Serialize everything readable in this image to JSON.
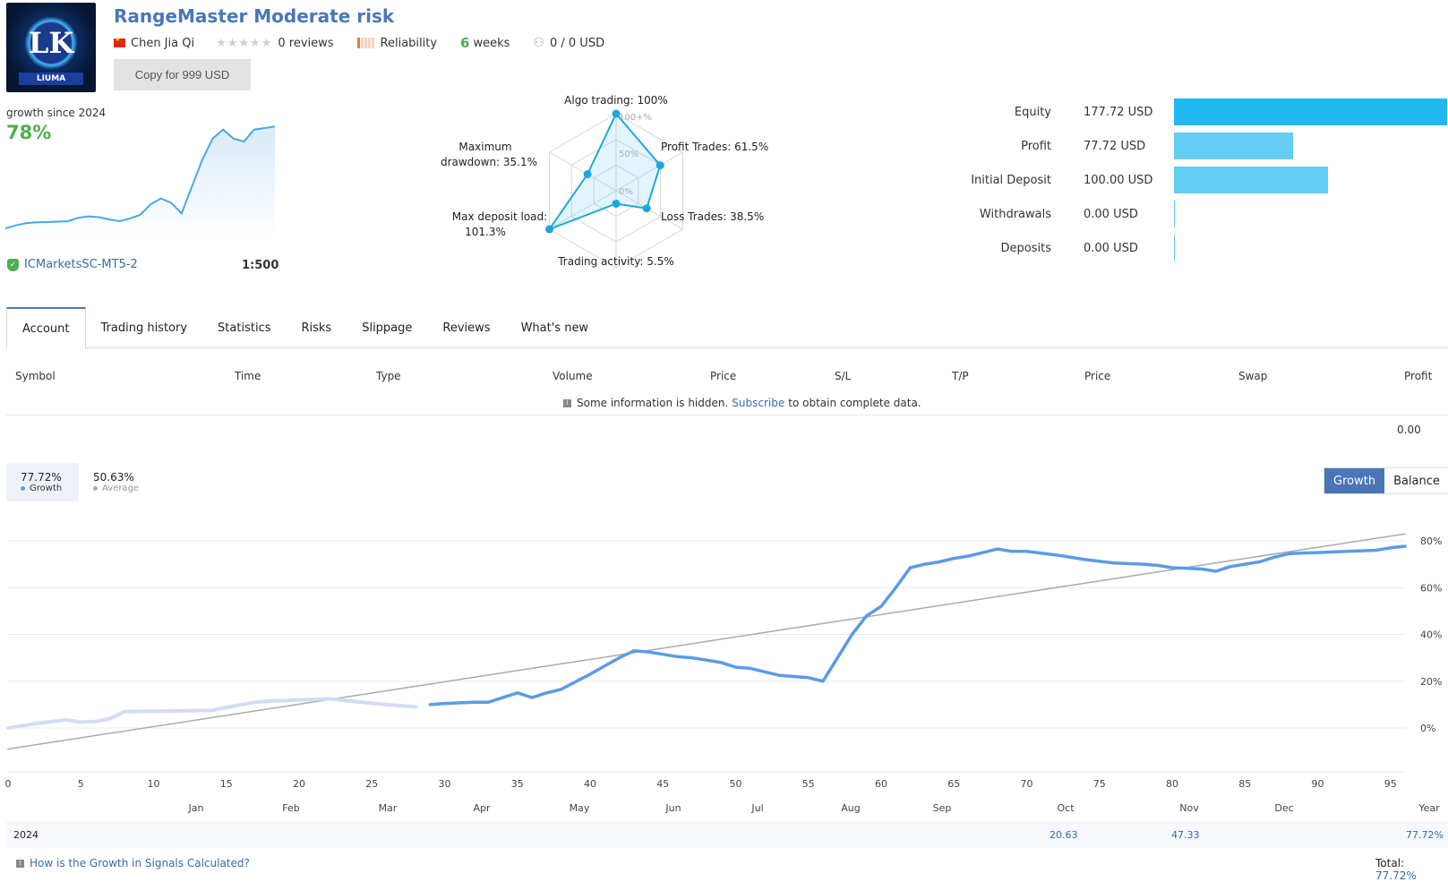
{
  "header": {
    "logo_text": "LK",
    "logo_ribbon": "LIUMA",
    "title": "RangeMaster Moderate risk",
    "author": "Chen Jia Qi",
    "reviews": "0 reviews",
    "rating_stars": 0,
    "reliability_label": "Reliability",
    "reliability_level": 1,
    "weeks_num": "6",
    "weeks_label": "weeks",
    "subscribers": "0 / 0 USD",
    "copy_button": "Copy for 999 USD"
  },
  "summary": {
    "growth_label": "growth since 2024",
    "growth_value": "78%",
    "server": "ICMarketsSC-MT5-2",
    "leverage": "1:500",
    "mini_chart": [
      0,
      2,
      3.5,
      4,
      4.2,
      4.5,
      4.7,
      7,
      8,
      7.5,
      6,
      4.8,
      6.5,
      9,
      16,
      20,
      17,
      10,
      28,
      46,
      60,
      66,
      60,
      58,
      66,
      67,
      68
    ]
  },
  "radar": {
    "scale_labels": [
      "100+%",
      "50%",
      "0%"
    ],
    "axes": [
      {
        "label": "Algo trading: 100%",
        "value": 100
      },
      {
        "label": "Profit Trades: 61.5%",
        "value": 61.5
      },
      {
        "label": "Loss Trades: 38.5%",
        "value": 38.5
      },
      {
        "label": "Trading activity: 5.5%",
        "value": 5.5
      },
      {
        "label_line1": "Max deposit load:",
        "label_line2": "101.3%",
        "value": 101.3
      },
      {
        "label_line1": "Maximum",
        "label_line2": "drawdown: 35.1%",
        "value": 35.1
      }
    ]
  },
  "balance_bars": [
    {
      "label": "Equity",
      "value": "177.72 USD",
      "amount": 177.72,
      "color": "#22b8f0"
    },
    {
      "label": "Profit",
      "value": "77.72 USD",
      "amount": 77.72,
      "color": "#63cdf4"
    },
    {
      "label": "Initial Deposit",
      "value": "100.00 USD",
      "amount": 100.0,
      "color": "#63cdf4"
    },
    {
      "label": "Withdrawals",
      "value": "0.00 USD",
      "amount": 0,
      "color": "#63cdf4"
    },
    {
      "label": "Deposits",
      "value": "0.00 USD",
      "amount": 0,
      "color": "#63cdf4"
    }
  ],
  "tabs": [
    "Account",
    "Trading history",
    "Statistics",
    "Risks",
    "Slippage",
    "Reviews",
    "What's new"
  ],
  "active_tab": "Account",
  "table": {
    "columns": [
      "Symbol",
      "Time",
      "Type",
      "Volume",
      "Price",
      "S/L",
      "T/P",
      "Price",
      "Swap",
      "Profit"
    ],
    "hidden_prefix": "Some information is hidden.",
    "hidden_link": "Subscribe",
    "hidden_suffix": "to obtain complete data.",
    "total_profit": "0.00"
  },
  "growth_chart": {
    "legend_growth_value": "77.72%",
    "legend_growth_label": "Growth",
    "legend_average_value": "50.63%",
    "legend_average_label": "Average",
    "toggle": [
      "Growth",
      "Balance"
    ],
    "active_toggle": "Growth",
    "year_label": "2024",
    "month_values": {
      "Oct": "20.63",
      "Nov": "47.33"
    },
    "year_total": "77.72%",
    "help_link": "How is the Growth in Signals Calculated?",
    "total_label": "Total:",
    "total_value": "77.72%"
  },
  "chart_data": {
    "type": "line",
    "title": "",
    "xlabel": "",
    "ylabel": "",
    "x_ticks": [
      0,
      5,
      10,
      15,
      20,
      25,
      30,
      35,
      40,
      45,
      50,
      55,
      60,
      65,
      70,
      75,
      80,
      85,
      90,
      95
    ],
    "y_ticks": [
      "0%",
      "20%",
      "40%",
      "60%",
      "80%"
    ],
    "xlim": [
      0,
      96
    ],
    "ylim": [
      -18,
      90
    ],
    "month_labels": [
      "Jan",
      "Feb",
      "Mar",
      "Apr",
      "May",
      "Jun",
      "Jul",
      "Aug",
      "Sep",
      "Oct",
      "Nov",
      "Dec",
      "Year"
    ],
    "grid": true,
    "series": [
      {
        "name": "Growth (before signal start)",
        "color": "#d3dcf5",
        "x": [
          0,
          2,
          4,
          5,
          6,
          7,
          8,
          10,
          12,
          14,
          16,
          17,
          18,
          20,
          22,
          24,
          26,
          28
        ],
        "y": [
          0,
          2,
          3.5,
          2.5,
          2.8,
          4,
          7,
          7.2,
          7.3,
          7.5,
          10,
          11,
          11.5,
          12,
          12.5,
          11.2,
          10,
          9
        ]
      },
      {
        "name": "Growth",
        "color": "#5b9be6",
        "x": [
          29,
          30,
          32,
          33,
          34,
          35,
          36,
          37,
          38,
          40,
          42,
          43,
          44,
          45,
          46,
          47,
          48,
          49,
          50,
          51,
          52,
          53,
          54,
          55,
          56,
          57,
          58,
          59,
          60,
          61,
          62,
          63,
          64,
          65,
          66,
          67,
          68,
          69,
          70,
          72,
          74,
          76,
          78,
          79,
          80,
          82,
          83,
          84,
          85,
          86,
          87,
          88,
          89,
          90,
          92,
          94,
          95,
          96
        ],
        "y": [
          10,
          10.5,
          11,
          11,
          13,
          15,
          13,
          15,
          16.5,
          23,
          30,
          33,
          32.5,
          31.5,
          30.5,
          30,
          29,
          28,
          26,
          25.5,
          24,
          22.5,
          22,
          21.5,
          20,
          30,
          40,
          48,
          52,
          60,
          68.5,
          70,
          71,
          72.5,
          73.5,
          75,
          76.5,
          75.5,
          75.5,
          74,
          72,
          70.5,
          70,
          69.5,
          68.5,
          68,
          67,
          69,
          70,
          71,
          73,
          74.5,
          74.8,
          75,
          75.5,
          76,
          77,
          77.72
        ]
      },
      {
        "name": "Average",
        "color": "#aaaaaa",
        "x": [
          0,
          96
        ],
        "y": [
          -9,
          83
        ]
      }
    ]
  }
}
